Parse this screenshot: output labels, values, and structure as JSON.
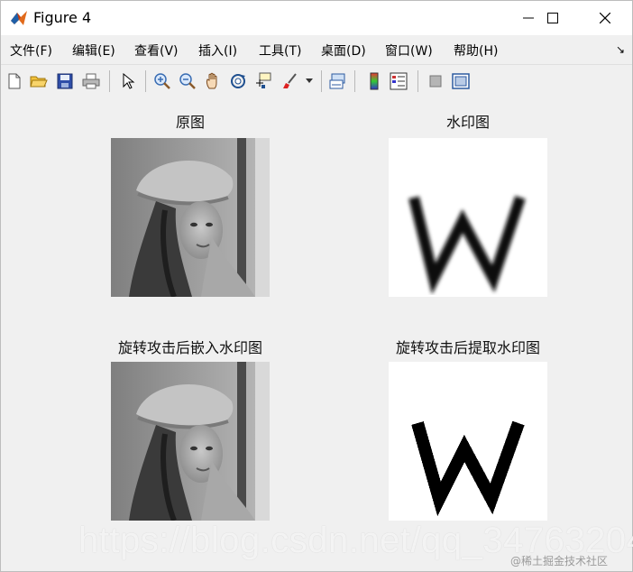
{
  "window": {
    "title": "Figure 4"
  },
  "menu": [
    {
      "id": "file",
      "label": "文件(F)"
    },
    {
      "id": "edit",
      "label": "编辑(E)"
    },
    {
      "id": "view",
      "label": "查看(V)"
    },
    {
      "id": "insert",
      "label": "插入(I)"
    },
    {
      "id": "tools",
      "label": "工具(T)"
    },
    {
      "id": "desktop",
      "label": "桌面(D)"
    },
    {
      "id": "window",
      "label": "窗口(W)"
    },
    {
      "id": "help",
      "label": "帮助(H)"
    }
  ],
  "menu_arrow": "↘",
  "toolbar": {
    "icons": [
      "new-figure-icon",
      "open-icon",
      "save-icon",
      "print-icon",
      "pointer-icon",
      "zoom-in-icon",
      "zoom-out-icon",
      "pan-icon",
      "rotate-3d-icon",
      "data-cursor-icon",
      "brush-icon",
      "dropdown-icon",
      "link-plot-icon",
      "colorbar-icon",
      "legend-icon",
      "hide-plot-tools-icon",
      "show-plot-tools-icon"
    ]
  },
  "plots": [
    {
      "id": "original",
      "title": "原图",
      "content": "lena-image"
    },
    {
      "id": "watermark",
      "title": "水印图",
      "content": "w-watermark-blurred"
    },
    {
      "id": "rotated-embedded",
      "title": "旋转攻击后嵌入水印图",
      "content": "lena-image"
    },
    {
      "id": "rotated-extracted",
      "title": "旋转攻击后提取水印图",
      "content": "w-watermark-binary"
    }
  ],
  "overlay": {
    "url_watermark": "https://blog.csdn.net/qq_34763204",
    "credit": "@稀土掘金技术社区"
  },
  "colors": {
    "background": "#f0f0f0",
    "titlebar": "#ffffff",
    "plot_bg": "#ffffff"
  }
}
